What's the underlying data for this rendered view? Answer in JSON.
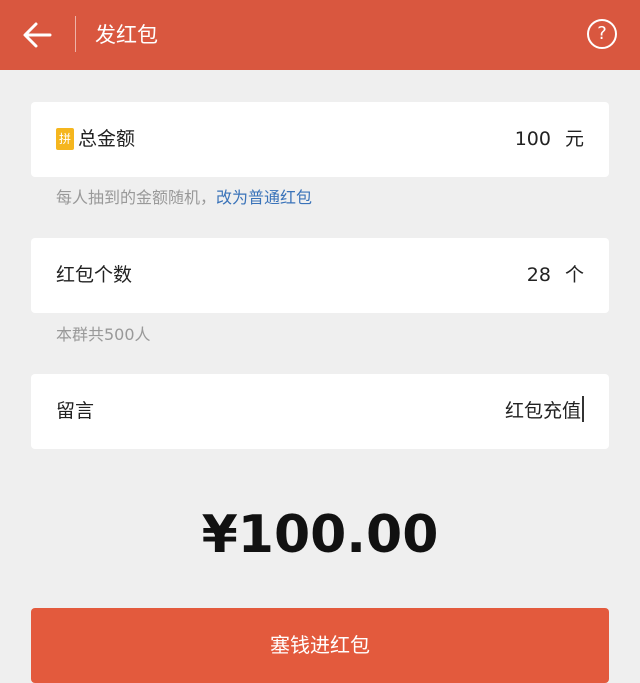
{
  "header": {
    "title": "发红包",
    "help_symbol": "?"
  },
  "total_amount": {
    "badge": "拼",
    "label": "总金额",
    "value": "100",
    "unit": "元"
  },
  "amount_hint": {
    "text": "每人抽到的金额随机，",
    "link": "改为普通红包"
  },
  "count": {
    "label": "红包个数",
    "value": "28",
    "unit": "个"
  },
  "count_hint": {
    "text": "本群共500人"
  },
  "message": {
    "label": "留言",
    "value": "红包充值"
  },
  "display_amount": "¥100.00",
  "submit": {
    "label": "塞钱进红包"
  },
  "colors": {
    "header_bg": "#d9573f",
    "page_bg": "#efefef",
    "badge": "#f5b61e",
    "link": "#3a73b9",
    "submit_bg": "#e35a3d"
  },
  "icons": {
    "back": "arrow-left-icon",
    "help": "question-circle-icon"
  }
}
